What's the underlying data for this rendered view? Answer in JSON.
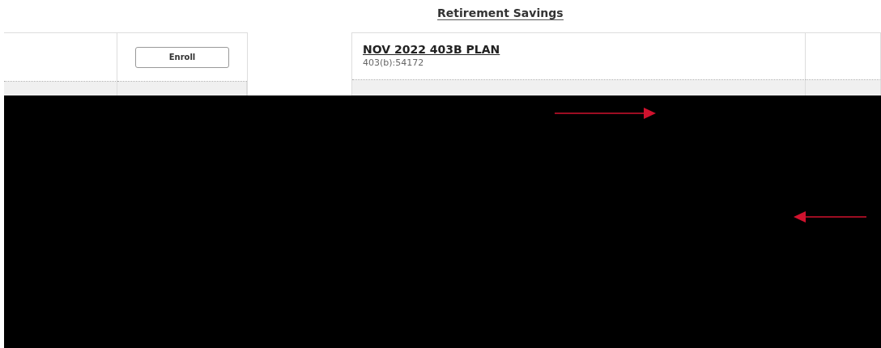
{
  "header": {
    "title": "Retirement Savings"
  },
  "left_table": {
    "button": "Enroll"
  },
  "plan": {
    "name": "NOV 2022 403B PLAN",
    "detail": "403(b):54172"
  }
}
